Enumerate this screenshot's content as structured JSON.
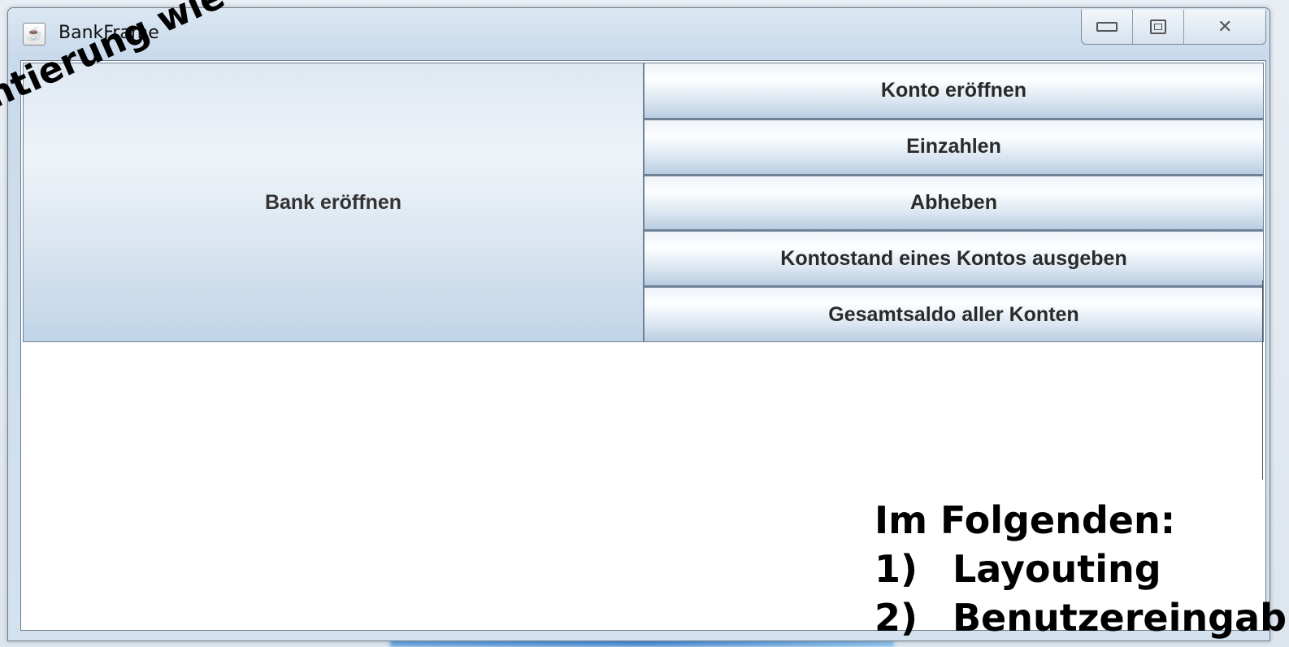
{
  "window": {
    "title": "BankFrame",
    "controls": [
      "minimize",
      "maximize",
      "close"
    ]
  },
  "buttons": {
    "bank_open": "Bank eröffnen",
    "right_column": [
      "Konto eröffnen",
      "Einzahlen",
      "Abheben",
      "Kontostand eines Kontos ausgeben",
      "Gesamtsaldo aller Konten"
    ]
  },
  "overlay": {
    "diagonal_text": "ementierung wie bishe",
    "heading": "Im Folgenden:",
    "items": [
      {
        "num": "1)",
        "label": "Layouting"
      },
      {
        "num": "2)",
        "label": "Benutzereingab"
      }
    ]
  }
}
